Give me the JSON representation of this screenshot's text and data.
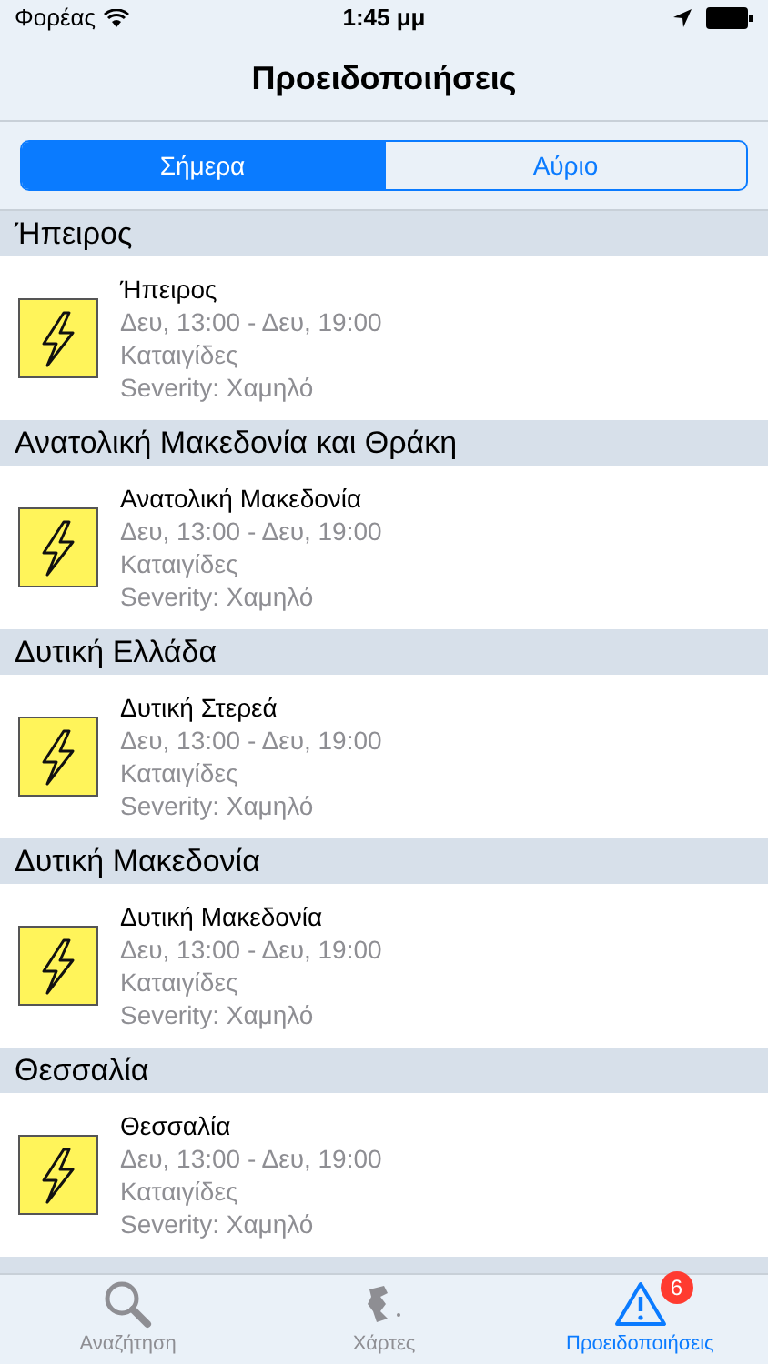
{
  "status_bar": {
    "carrier": "Φορέας",
    "time": "1:45 μμ"
  },
  "nav": {
    "title": "Προειδοποιήσεις"
  },
  "segments": [
    {
      "label": "Σήμερα",
      "selected": true
    },
    {
      "label": "Αύριο",
      "selected": false
    }
  ],
  "sections": [
    {
      "title": "Ήπειρος",
      "items": [
        {
          "name": "Ήπειρος",
          "period": "Δευ, 13:00 - Δευ, 19:00",
          "type": "Καταιγίδες",
          "severity": "Severity: Χαμηλό"
        }
      ]
    },
    {
      "title": "Ανατολική Μακεδονία και Θράκη",
      "items": [
        {
          "name": "Ανατολική Μακεδονία",
          "period": "Δευ, 13:00 - Δευ, 19:00",
          "type": "Καταιγίδες",
          "severity": "Severity: Χαμηλό"
        }
      ]
    },
    {
      "title": "Δυτική Ελλάδα",
      "items": [
        {
          "name": "Δυτική Στερεά",
          "period": "Δευ, 13:00 - Δευ, 19:00",
          "type": "Καταιγίδες",
          "severity": "Severity: Χαμηλό"
        }
      ]
    },
    {
      "title": "Δυτική Μακεδονία",
      "items": [
        {
          "name": "Δυτική Μακεδονία",
          "period": "Δευ, 13:00 - Δευ, 19:00",
          "type": "Καταιγίδες",
          "severity": "Severity: Χαμηλό"
        }
      ]
    },
    {
      "title": "Θεσσαλία",
      "items": [
        {
          "name": "Θεσσαλία",
          "period": "Δευ, 13:00 - Δευ, 19:00",
          "type": "Καταιγίδες",
          "severity": "Severity: Χαμηλό"
        }
      ]
    }
  ],
  "tab_bar": [
    {
      "kind": "search",
      "label": "Αναζήτηση",
      "selected": false
    },
    {
      "kind": "map",
      "label": "Χάρτες",
      "selected": false
    },
    {
      "kind": "warning",
      "label": "Προειδοποιήσεις",
      "selected": true,
      "badge": "6"
    }
  ]
}
